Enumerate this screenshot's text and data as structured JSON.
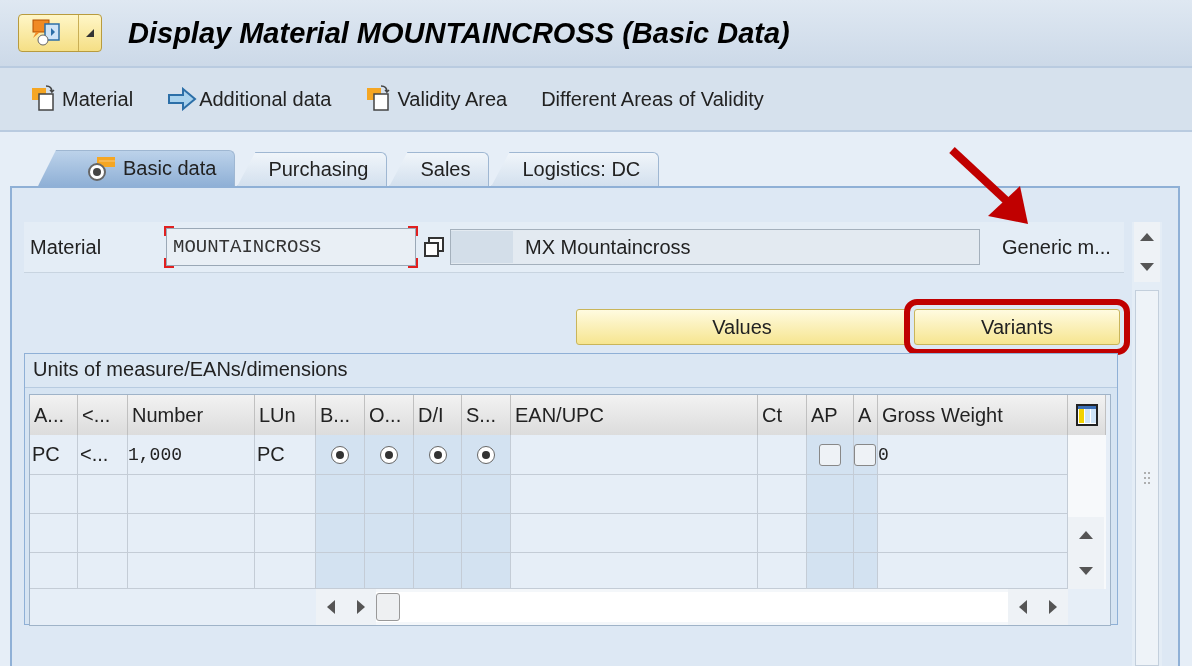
{
  "window": {
    "title": "Display Material MOUNTAINCROSS (Basic Data)"
  },
  "toolbar": [
    {
      "label": "Material",
      "kind": "document"
    },
    {
      "label": "Additional data",
      "kind": "arrow"
    },
    {
      "label": "Validity Area",
      "kind": "document"
    },
    {
      "label": "Different Areas of Validity",
      "kind": "plain"
    }
  ],
  "tabs": [
    {
      "label": "Basic data",
      "selected": true
    },
    {
      "label": "Purchasing",
      "selected": false
    },
    {
      "label": "Sales",
      "selected": false
    },
    {
      "label": "Logistics: DC",
      "selected": false
    }
  ],
  "material": {
    "label": "Material",
    "value": "MOUNTAINCROSS",
    "description": "MX Mountaincross",
    "type_text": "Generic m..."
  },
  "pointer_arrow": true,
  "buttons": [
    {
      "label": "Values",
      "highlighted": false
    },
    {
      "label": "Variants",
      "highlighted": true
    }
  ],
  "group": {
    "title": "Units of measure/EANs/dimensions",
    "columns": [
      "A...",
      "<...",
      "Number",
      "LUn",
      "B...",
      "O...",
      "D/I",
      "S...",
      "EAN/UPC",
      "Ct",
      "AP",
      "A",
      "Gross Weight"
    ],
    "rows": [
      {
        "cells": [
          {
            "kind": "text",
            "text": "PC"
          },
          {
            "kind": "text",
            "text": "<..."
          },
          {
            "kind": "mono",
            "text": "1,000"
          },
          {
            "kind": "text",
            "text": "PC"
          },
          {
            "kind": "radio",
            "selected": true
          },
          {
            "kind": "radio",
            "selected": true
          },
          {
            "kind": "radio",
            "selected": true
          },
          {
            "kind": "radio",
            "selected": true
          },
          {
            "kind": "empty"
          },
          {
            "kind": "empty"
          },
          {
            "kind": "checkbox",
            "checked": false
          },
          {
            "kind": "checkbox",
            "checked": false
          },
          {
            "kind": "mono",
            "text": "0"
          }
        ]
      }
    ]
  }
}
